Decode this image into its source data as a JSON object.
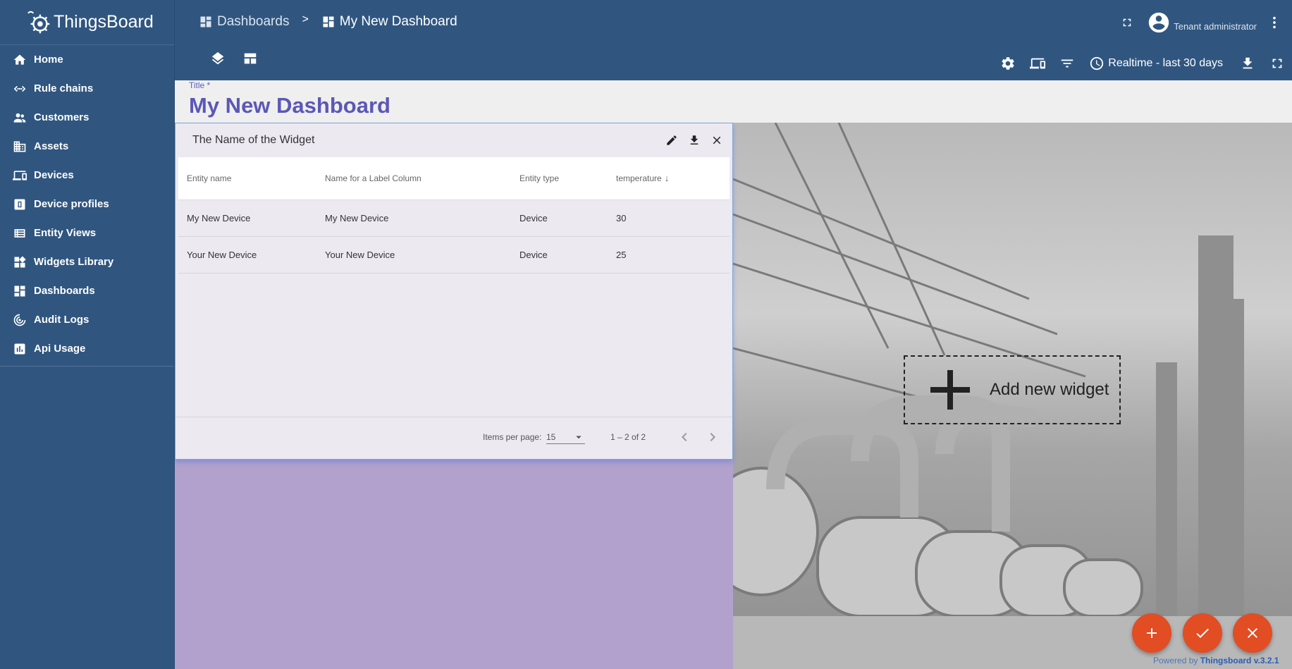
{
  "app": {
    "name": "ThingsBoard"
  },
  "sidebar": {
    "items": [
      {
        "label": "Home",
        "icon": "home-icon"
      },
      {
        "label": "Rule chains",
        "icon": "rule-chain-icon"
      },
      {
        "label": "Customers",
        "icon": "customers-icon"
      },
      {
        "label": "Assets",
        "icon": "assets-icon"
      },
      {
        "label": "Devices",
        "icon": "devices-icon"
      },
      {
        "label": "Device profiles",
        "icon": "device-profile-icon"
      },
      {
        "label": "Entity Views",
        "icon": "entity-views-icon"
      },
      {
        "label": "Widgets Library",
        "icon": "widgets-icon"
      },
      {
        "label": "Dashboards",
        "icon": "dashboards-icon"
      },
      {
        "label": "Audit Logs",
        "icon": "audit-logs-icon"
      },
      {
        "label": "Api Usage",
        "icon": "api-usage-icon"
      }
    ]
  },
  "header": {
    "breadcrumb": [
      "Dashboards",
      "My New Dashboard"
    ],
    "breadcrumb_separator": ">",
    "user_label": "Tenant administrator"
  },
  "toolbar": {
    "timewindow": "Realtime - last 30 days"
  },
  "title_area": {
    "label": "Title *",
    "title": "My New Dashboard"
  },
  "widget": {
    "title": "The Name of the Widget",
    "columns": [
      "Entity name",
      "Name for a Label Column",
      "Entity type",
      "temperature"
    ],
    "sort_indicator": "↓",
    "rows": [
      [
        "My New Device",
        "My New Device",
        "Device",
        "30"
      ],
      [
        "Your New Device",
        "Your New Device",
        "Device",
        "25"
      ]
    ],
    "paginator": {
      "items_per_page_label": "Items per page:",
      "items_per_page_value": "15",
      "range_label": "1 – 2 of 2"
    }
  },
  "add_widget": {
    "label": "Add new widget"
  },
  "footer": {
    "powered_prefix": "Powered by",
    "powered_link": "Thingsboard v.3.2.1"
  },
  "colors": {
    "primary": "#305680",
    "accent": "#e24d24",
    "title": "#5c57b6",
    "canvas_purple": "#b2a1cd"
  }
}
